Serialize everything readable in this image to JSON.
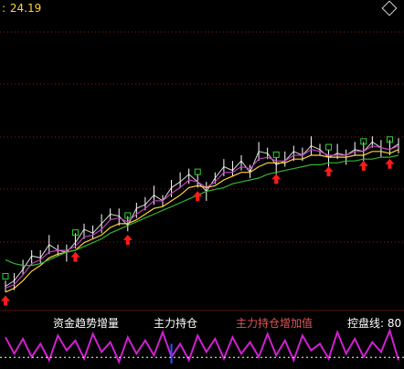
{
  "header": {
    "label": ":",
    "value": "24.19",
    "colors": {
      "text": "#ffd23a"
    },
    "corner_icon": "diamond-outline-icon"
  },
  "indicator_legend": {
    "items": [
      {
        "label": "资金趋势增量",
        "color": "#ffffff"
      },
      {
        "label": "主力持仓",
        "color": "#ffffff"
      },
      {
        "label": "主力持仓增加值",
        "color": "#e05555"
      },
      {
        "label": "控盘线: 80",
        "color": "#ffffff"
      }
    ]
  },
  "colors": {
    "background": "#000000",
    "grid": "#8a1d1d",
    "price": "#ffffff",
    "ma_fast": "#ffd23a",
    "ma_mid": "#c040c0",
    "ma_long": "#31b531",
    "signal_buy": "#ff1a1a",
    "marker_green": "#31d031",
    "indicator_magenta": "#d020d0",
    "indicator_blue": "#3050ff",
    "baseline": "#ffffff"
  },
  "chart_data": [
    {
      "type": "line",
      "series": [
        {
          "values": [
            6,
            9,
            15,
            22,
            21,
            28,
            25,
            24,
            29,
            36,
            34,
            39,
            44,
            43,
            38,
            47,
            49,
            54,
            51,
            58,
            61,
            65,
            61,
            56,
            63,
            69,
            67,
            72,
            66,
            77,
            76,
            70,
            72,
            77,
            75,
            80,
            78,
            74,
            76,
            75,
            78,
            77,
            82,
            79,
            78,
            81
          ]
        },
        {
          "values": [
            5,
            7,
            12,
            18,
            20,
            24,
            25,
            25,
            27,
            32,
            33,
            36,
            41,
            42,
            40,
            44,
            47,
            51,
            51,
            55,
            58,
            62,
            61,
            58,
            61,
            66,
            66,
            69,
            68,
            73,
            74,
            72,
            72,
            75,
            75,
            78,
            77,
            75,
            75,
            75,
            77,
            77,
            80,
            79,
            78,
            80
          ]
        },
        {
          "values": [
            3,
            5,
            9,
            14,
            17,
            21,
            23,
            24,
            25,
            29,
            31,
            33,
            37,
            39,
            39,
            41,
            44,
            47,
            48,
            51,
            54,
            58,
            59,
            58,
            59,
            62,
            64,
            66,
            66,
            69,
            71,
            71,
            71,
            73,
            73,
            75,
            75,
            74,
            74,
            74,
            75,
            75,
            77,
            77,
            76,
            78
          ]
        },
        {
          "values": [
            20,
            18,
            17,
            17,
            18,
            20,
            22,
            24,
            25,
            27,
            29,
            31,
            34,
            36,
            38,
            40,
            42,
            44,
            46,
            48,
            50,
            52,
            54,
            56,
            57,
            58,
            60,
            61,
            62,
            63,
            65,
            66,
            67,
            68,
            69,
            70,
            70,
            71,
            71,
            72,
            72,
            73,
            73,
            74,
            74,
            75
          ]
        }
      ],
      "signals": [
        {
          "kind": "buy",
          "at": 0
        },
        {
          "kind": "buy",
          "at": 8
        },
        {
          "kind": "buy",
          "at": 14
        },
        {
          "kind": "buy",
          "at": 22
        },
        {
          "kind": "buy",
          "at": 31
        },
        {
          "kind": "buy",
          "at": 37
        },
        {
          "kind": "buy",
          "at": 41
        },
        {
          "kind": "buy",
          "at": 44
        }
      ]
    },
    {
      "type": "line",
      "series": [
        {
          "values": [
            80,
            30,
            75,
            20,
            60,
            10,
            85,
            40,
            70,
            15,
            90,
            35,
            65,
            5,
            80,
            30,
            70,
            25,
            95,
            20,
            60,
            10,
            85,
            35,
            75,
            15,
            80,
            30,
            65,
            20,
            90,
            25,
            70,
            10,
            85,
            40,
            60,
            15,
            95,
            30,
            75,
            20,
            65,
            35,
            100,
            10
          ]
        },
        {
          "values": [
            0,
            0,
            0,
            0,
            0,
            0,
            0,
            0,
            0,
            0,
            0,
            0,
            0,
            0,
            0,
            0,
            0,
            0,
            0,
            60,
            0,
            0,
            0,
            0,
            0,
            0,
            0,
            0,
            0,
            0,
            0,
            0,
            0,
            0,
            0,
            0,
            0,
            0,
            0,
            0,
            0,
            0,
            0,
            0,
            0,
            0
          ]
        }
      ],
      "reference_lines": [
        80
      ]
    }
  ]
}
